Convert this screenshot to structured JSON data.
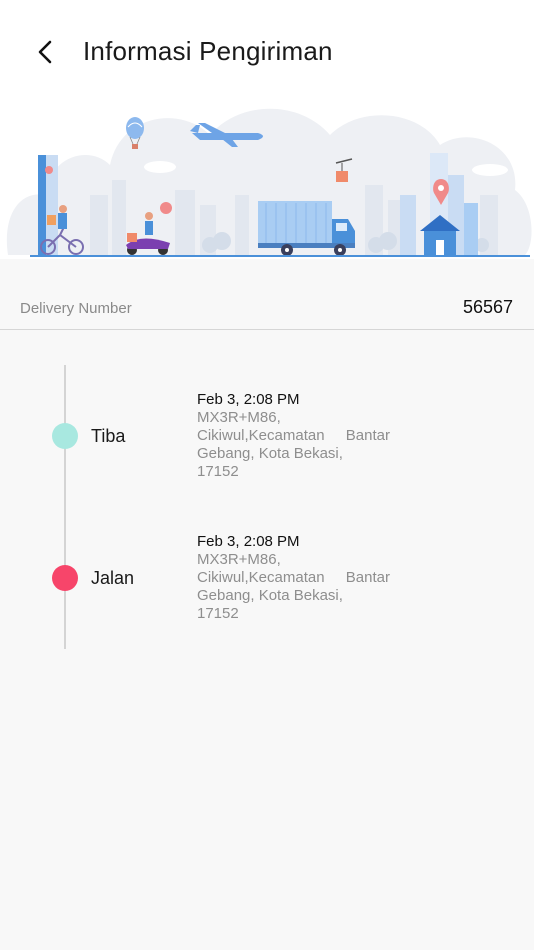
{
  "header": {
    "title": "Informasi Pengiriman",
    "back_icon": "chevron-left-icon"
  },
  "banner": {
    "illustration": "delivery-city-illustration",
    "colors": {
      "sky": "#eef0f4",
      "city": "#dfe5ee",
      "truck": "#8db9ee",
      "accent": "#f08a8a",
      "ground": "#4a90d9"
    }
  },
  "delivery": {
    "label": "Delivery Number",
    "value": "56567"
  },
  "timeline": [
    {
      "status": "Tiba",
      "color": "#a8e8e0",
      "time": "Feb 3, 2:08 PM",
      "address": "MX3R+M86,\nCikiwul,Kecamatan Bantar Gebang, Kota Bekasi,\n17152"
    },
    {
      "status": "Jalan",
      "color": "#f7456a",
      "time": "Feb 3, 2:08 PM",
      "address": "MX3R+M86,\nCikiwul,Kecamatan Bantar Gebang, Kota Bekasi,\n17152"
    }
  ]
}
